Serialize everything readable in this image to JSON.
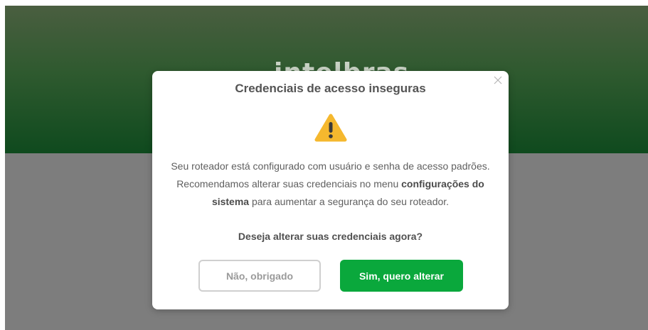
{
  "background": {
    "brand_logo": "intelbras",
    "header_color": "#0f4a1e",
    "backdrop_color": "#7d7d7d"
  },
  "dialog": {
    "title": "Credenciais de acesso inseguras",
    "icon": "warning-icon",
    "icon_color": "#f5b82e",
    "message_line1": "Seu roteador está configurado com usuário e senha de acesso padrões.",
    "message_part2": "Recomendamos alterar suas credenciais no menu",
    "message_bold": "configurações do sistema",
    "message_part3": "para aumentar a segurança do seu roteador.",
    "question": "Deseja alterar suas credenciais agora?",
    "decline_label": "Não, obrigado",
    "accept_label": "Sim, quero alterar",
    "accept_color": "#0aa83c",
    "close_icon": "close-icon"
  }
}
